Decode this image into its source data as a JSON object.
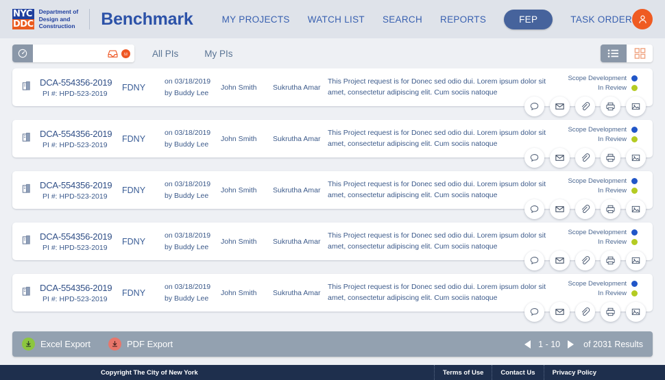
{
  "header": {
    "logo": {
      "line1": "NYC",
      "line2": "DDC",
      "department": "Department of\nDesign and\nConstruction"
    },
    "app_title": "Benchmark",
    "nav": [
      {
        "label": "MY PROJECTS",
        "active": false
      },
      {
        "label": "WATCH LIST",
        "active": false
      },
      {
        "label": "SEARCH",
        "active": false
      },
      {
        "label": "REPORTS",
        "active": false
      },
      {
        "label": "FEP",
        "active": true
      },
      {
        "label": "TASK ORDER",
        "active": false
      }
    ],
    "avatar_icon": "user-icon",
    "bg_color": "#dfe3ea",
    "accent_blue": "#2c52a8",
    "accent_orange": "#ef5b22"
  },
  "toolbar": {
    "search": {
      "value": "",
      "placeholder": "",
      "gauge_icon": "gauge-icon",
      "inbox_icon": "inbox-icon",
      "badge_icon": "badge-icon"
    },
    "tabs": [
      {
        "label": "All PIs",
        "active": true
      },
      {
        "label": "My PIs",
        "active": false
      }
    ],
    "views": [
      {
        "name": "list-view",
        "icon": "list-icon",
        "active": true
      },
      {
        "name": "grid-view",
        "icon": "grid-icon",
        "active": false
      }
    ]
  },
  "rows": [
    {
      "doc_icon": "building-icon",
      "id": "DCA-554356-2019",
      "sub": "PI #: HPD-523-2019",
      "agency": "FDNY",
      "date_line1": "on 03/18/2019",
      "date_line2": "by Buddy Lee",
      "person1": "John Smith",
      "person2": "Sukrutha Amar",
      "description": "This Project request is for Donec sed odio dui. Lorem ipsum dolor sit amet, consectetur adipiscing elit. Cum sociis natoque",
      "status1": {
        "label": "Scope Development",
        "color": "#2156c8"
      },
      "status2": {
        "label": "In Review",
        "color": "#b4cb22"
      },
      "actions": [
        "comment-icon",
        "mail-icon",
        "attachment-icon",
        "print-icon",
        "image-icon"
      ]
    },
    {
      "doc_icon": "building-icon",
      "id": "DCA-554356-2019",
      "sub": "PI #: HPD-523-2019",
      "agency": "FDNY",
      "date_line1": "on 03/18/2019",
      "date_line2": "by Buddy Lee",
      "person1": "John Smith",
      "person2": "Sukrutha Amar",
      "description": "This Project request is for Donec sed odio dui. Lorem ipsum dolor sit amet, consectetur adipiscing elit. Cum sociis natoque",
      "status1": {
        "label": "Scope Development",
        "color": "#2156c8"
      },
      "status2": {
        "label": "In Review",
        "color": "#b4cb22"
      },
      "actions": [
        "comment-icon",
        "mail-icon",
        "attachment-icon",
        "print-icon",
        "image-icon"
      ]
    },
    {
      "doc_icon": "building-icon",
      "id": "DCA-554356-2019",
      "sub": "PI #: HPD-523-2019",
      "agency": "FDNY",
      "date_line1": "on 03/18/2019",
      "date_line2": "by Buddy Lee",
      "person1": "John Smith",
      "person2": "Sukrutha Amar",
      "description": "This Project request is for Donec sed odio dui. Lorem ipsum dolor sit amet, consectetur adipiscing elit. Cum sociis natoque",
      "status1": {
        "label": "Scope Development",
        "color": "#2156c8"
      },
      "status2": {
        "label": "In Review",
        "color": "#b4cb22"
      },
      "actions": [
        "comment-icon",
        "mail-icon",
        "attachment-icon",
        "print-icon",
        "image-icon"
      ]
    },
    {
      "doc_icon": "building-icon",
      "id": "DCA-554356-2019",
      "sub": "PI #: HPD-523-2019",
      "agency": "FDNY",
      "date_line1": "on 03/18/2019",
      "date_line2": "by Buddy Lee",
      "person1": "John Smith",
      "person2": "Sukrutha Amar",
      "description": "This Project request is for Donec sed odio dui. Lorem ipsum dolor sit amet, consectetur adipiscing elit. Cum sociis natoque",
      "status1": {
        "label": "Scope Development",
        "color": "#2156c8"
      },
      "status2": {
        "label": "In Review",
        "color": "#b4cb22"
      },
      "actions": [
        "comment-icon",
        "mail-icon",
        "attachment-icon",
        "print-icon",
        "image-icon"
      ]
    },
    {
      "doc_icon": "building-icon",
      "id": "DCA-554356-2019",
      "sub": "PI #: HPD-523-2019",
      "agency": "FDNY",
      "date_line1": "on 03/18/2019",
      "date_line2": "by Buddy Lee",
      "person1": "John Smith",
      "person2": "Sukrutha Amar",
      "description": "This Project request is for Donec sed odio dui. Lorem ipsum dolor sit amet, consectetur adipiscing elit. Cum sociis natoque",
      "status1": {
        "label": "Scope Development",
        "color": "#2156c8"
      },
      "status2": {
        "label": "In Review",
        "color": "#b4cb22"
      },
      "actions": [
        "comment-icon",
        "mail-icon",
        "attachment-icon",
        "print-icon",
        "image-icon"
      ]
    }
  ],
  "exportbar": {
    "excel": {
      "label": "Excel Export",
      "icon": "download-icon",
      "color": "#8cc63f"
    },
    "pdf": {
      "label": "PDF Export",
      "icon": "download-icon",
      "color": "#e8766b"
    },
    "pagination": {
      "prev_icon": "triangle-left-icon",
      "next_icon": "triangle-right-icon",
      "range": "1 - 10",
      "total": "of 2031 Results"
    }
  },
  "footer": {
    "copyright": "Copyright The City of New York",
    "links": [
      "Terms of Use",
      "Contact Us",
      "Privacy Policy"
    ]
  }
}
